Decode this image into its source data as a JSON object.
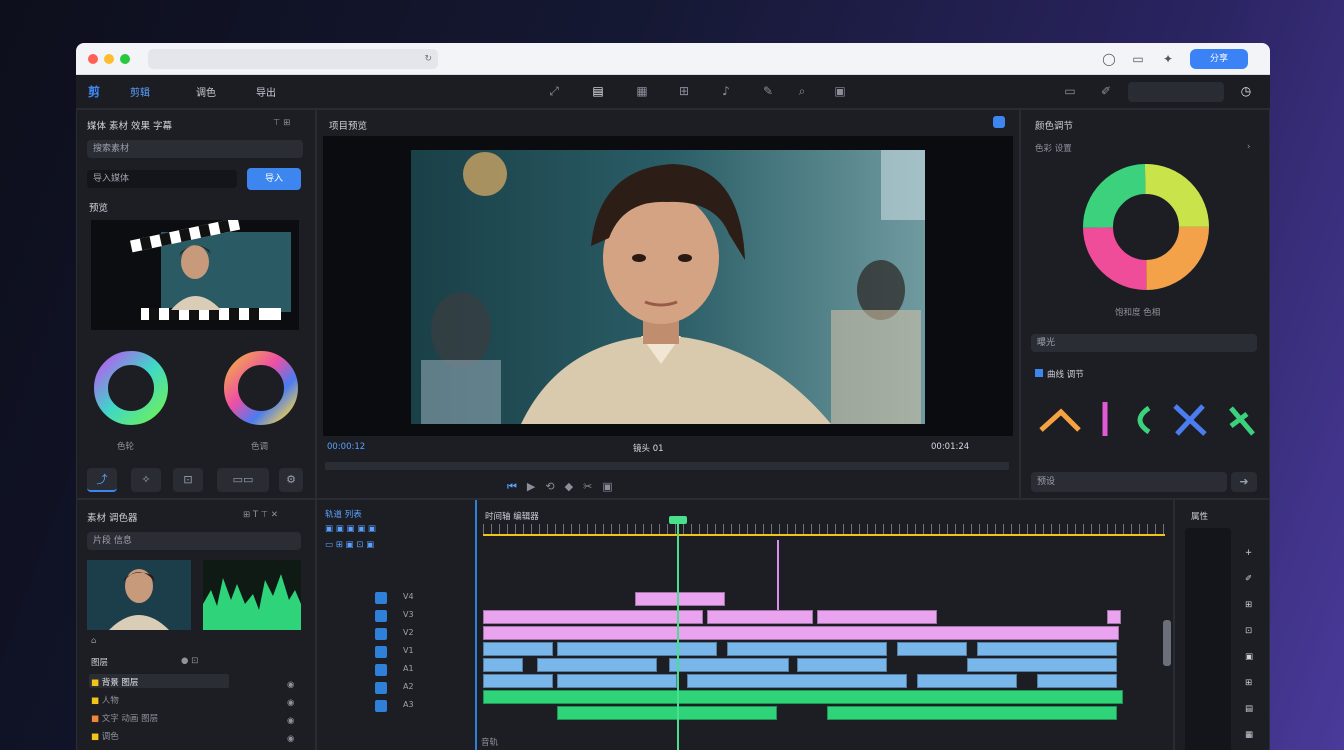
{
  "browser": {
    "url": "",
    "share_label": "分享"
  },
  "menu": [
    "剪辑",
    "调色",
    "导出"
  ],
  "left_panel": {
    "header": "媒体 素材 效果 字幕",
    "search_placeholder": "搜索素材",
    "import_field": "导入媒体",
    "import_button": "导入",
    "preview_title": "预览",
    "wheel_label_1": "色轮",
    "wheel_label_2": "色调"
  },
  "viewer": {
    "title": "项目预览",
    "timecode_left": "00:00:12",
    "clip_name": "镜头 01",
    "timecode_right": "00:01:24"
  },
  "right_panel": {
    "title": "颜色调节",
    "subtitle": "色彩 设置",
    "wheel_caption": "饱和度 色相",
    "slider_label": "曝光",
    "curves_title": "曲线 调节",
    "dropdown_label": "预设"
  },
  "media_panel": {
    "title": "素材 调色器",
    "field": "片段 信息",
    "section": "图层",
    "layers": [
      "背景 图层",
      "人物",
      "文字 动画 图层",
      "调色"
    ]
  },
  "timeline": {
    "title": "时间轴 编辑器",
    "track_header": "轨道 列表",
    "tracks": [
      "V4",
      "V3",
      "V2",
      "V1",
      "A1",
      "A2",
      "A3"
    ],
    "footer": "音轨"
  },
  "right_strip": {
    "title": "属性"
  },
  "colors": {
    "accent": "#3d86f0",
    "clip_pink": "#e9a3ef",
    "clip_blue": "#79b6ea",
    "clip_green": "#2fd47a",
    "playhead": "#48e08a",
    "ruler": "#f0c419"
  }
}
